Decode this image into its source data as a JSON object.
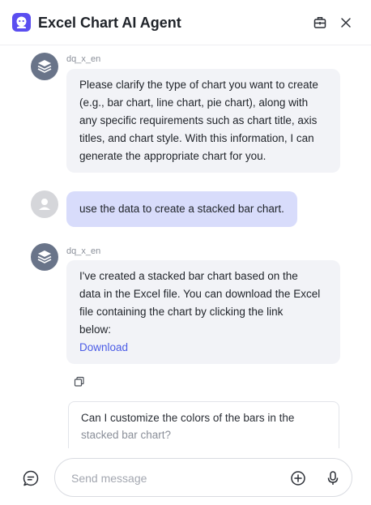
{
  "header": {
    "title": "Excel Chart AI Agent",
    "logo_icon": "robot-face-icon",
    "toolkit_icon": "toolbox-icon",
    "close_icon": "close-icon"
  },
  "messages": [
    {
      "role": "bot",
      "sender": "dq_x_en",
      "lines": [
        "Please clarify the type of chart you want to create",
        "(e.g., bar chart, line chart, pie chart), along with",
        "any specific requirements such as chart title, axis",
        "titles, and chart style. With this information, I can",
        "generate the appropriate chart for you."
      ]
    },
    {
      "role": "user",
      "text": "use the data to create a stacked bar chart."
    },
    {
      "role": "bot",
      "sender": "dq_x_en",
      "lines": [
        "I've created a stacked bar chart based on the",
        "data in the Excel file. You can download the Excel",
        "file containing the chart by clicking the link",
        "below:"
      ],
      "link_text": "Download"
    }
  ],
  "suggestion": {
    "line1": "Can I customize the colors of the bars in the",
    "line2": "stacked bar chart?"
  },
  "composer": {
    "placeholder": "Send message",
    "value": ""
  },
  "colors": {
    "accent": "#5b4ef0",
    "link": "#4b5ce6",
    "bot_bubble": "#f2f3f7",
    "user_bubble": "#d8dcfb"
  }
}
